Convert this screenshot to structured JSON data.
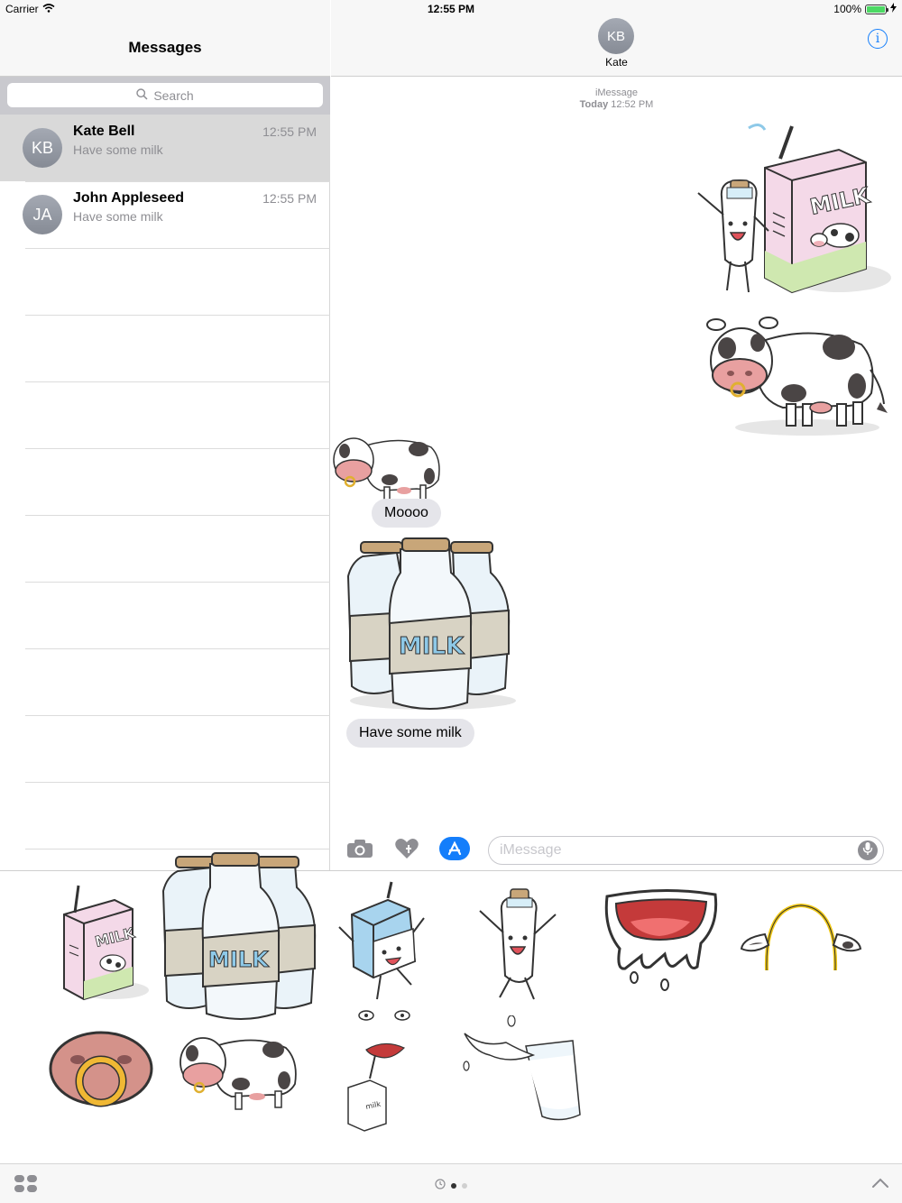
{
  "status_bar": {
    "carrier": "Carrier",
    "time": "12:55 PM",
    "battery": "100%",
    "battery_level": 1.0
  },
  "sidebar": {
    "title": "Messages",
    "search_placeholder": "Search",
    "conversations": [
      {
        "initials": "KB",
        "name": "Kate Bell",
        "preview": "Have some milk",
        "time": "12:55 PM",
        "selected": true
      },
      {
        "initials": "JA",
        "name": "John Appleseed",
        "preview": "Have some milk",
        "time": "12:55 PM",
        "selected": false
      }
    ]
  },
  "conversation": {
    "contact_initials": "KB",
    "contact_name": "Kate",
    "info_label": "i",
    "service": "iMessage",
    "date_label": "Today",
    "date_time": "12:52 PM",
    "messages": [
      {
        "kind": "sticker",
        "sticker": "milk-bottle-and-carton"
      },
      {
        "kind": "sticker",
        "sticker": "cow"
      },
      {
        "kind": "sticker",
        "sticker": "small-cow"
      },
      {
        "kind": "text",
        "text": "Moooo"
      },
      {
        "kind": "sticker",
        "sticker": "three-milk-bottles"
      },
      {
        "kind": "text",
        "text": "Have some milk"
      }
    ]
  },
  "compose": {
    "placeholder": "iMessage",
    "icons": [
      "camera-icon",
      "digital-touch-icon",
      "app-store-icon",
      "microphone-icon"
    ]
  },
  "sticker_drawer": {
    "stickers": [
      "milk-carton-with-cow",
      "three-milk-bottles",
      "milk-carton-character",
      "milk-bottle-character",
      "dripping-mouth",
      "cow-ears-headband",
      "cow-nose-ring",
      "cow",
      "milk-carton-with-lips",
      "milk-glass-splash"
    ],
    "bottle_label": "MILK",
    "carton_label": "MILK",
    "small_carton_label": "milk"
  },
  "bottom_bar": {
    "page_count": 2,
    "current_page": 1,
    "icons": [
      "app-drawer-icon",
      "recents-icon",
      "collapse-chevron-icon"
    ]
  },
  "colors": {
    "accent": "#147efb",
    "bubble": "#e5e5ea",
    "milk_blue": "#8ec9e8",
    "carton_pink": "#f3d6e6",
    "cow_pink": "#e8a0a0"
  }
}
